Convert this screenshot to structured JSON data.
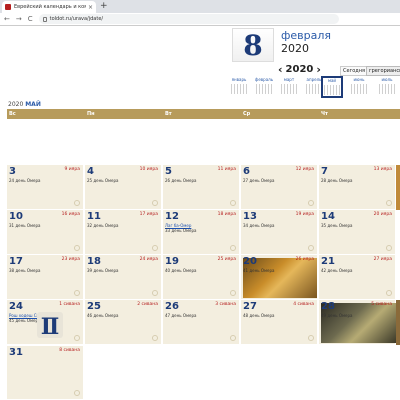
{
  "browser": {
    "tab_title": "Еврейский календарь и компь",
    "tab_close": "×",
    "newtab": "+",
    "back": "←",
    "forward": "→",
    "reload": "C",
    "url": "toldot.ru/urava/jdate/"
  },
  "header": {
    "day": "8",
    "month": "февраля",
    "year": "2020"
  },
  "year_nav": {
    "prev": "‹",
    "year": "2020",
    "next": "›"
  },
  "today_button": "Сегодня",
  "calendar_type": "грегорианский",
  "mini_months": [
    "январь",
    "февраль",
    "март",
    "апрель",
    "май",
    "июнь",
    "июль"
  ],
  "selected_month": {
    "year": "2020",
    "month": "МАЙ"
  },
  "weekdays": [
    "Вс",
    "Пн",
    "Вт",
    "Ср",
    "Чт"
  ],
  "weeks": [
    [
      {
        "day": "3",
        "ev": "9 ияра",
        "om": "24 день Омера"
      },
      {
        "day": "4",
        "ev": "10 ияра",
        "om": "25 день Омера"
      },
      {
        "day": "5",
        "ev": "11 ияра",
        "om": "26 день Омера"
      },
      {
        "day": "6",
        "ev": "12 ияра",
        "om": "27 день Омера"
      },
      {
        "day": "7",
        "ev": "13 ияра",
        "om": "28 день Омера"
      }
    ],
    [
      {
        "day": "10",
        "ev": "16 ияра",
        "om": "31 день Омера"
      },
      {
        "day": "11",
        "ev": "17 ияра",
        "om": "32 день Омера"
      },
      {
        "day": "12",
        "ev": "18 ияра",
        "om": "33 день Омера",
        "lnk": "Лаг ба-Омер"
      },
      {
        "day": "13",
        "ev": "19 ияра",
        "om": "34 день Омера"
      },
      {
        "day": "14",
        "ev": "20 ияра",
        "om": "35 день Омера"
      }
    ],
    [
      {
        "day": "17",
        "ev": "23 ияра",
        "om": "38 день Омера"
      },
      {
        "day": "18",
        "ev": "24 ияра",
        "om": "39 день Омера"
      },
      {
        "day": "19",
        "ev": "25 ияра",
        "om": "40 день Омера"
      },
      {
        "day": "20",
        "ev": "26 ияра",
        "om": "41 день Омера"
      },
      {
        "day": "21",
        "ev": "27 ияра",
        "om": "42 день Омера"
      }
    ],
    [
      {
        "day": "24",
        "ev": "1 сивана",
        "om": "45 день Омера",
        "lnk": "Рош ходеш Сиван"
      },
      {
        "day": "25",
        "ev": "2 сивана",
        "om": "46 день Омера"
      },
      {
        "day": "26",
        "ev": "3 сивана",
        "om": "47 день Омера"
      },
      {
        "day": "27",
        "ev": "4 сивана",
        "om": "48 день Омера"
      },
      {
        "day": "28",
        "ev": "5 сивана",
        "om": "49 день Омера"
      }
    ],
    [
      {
        "day": "31",
        "ev": "8 сивана",
        "om": ""
      }
    ]
  ]
}
